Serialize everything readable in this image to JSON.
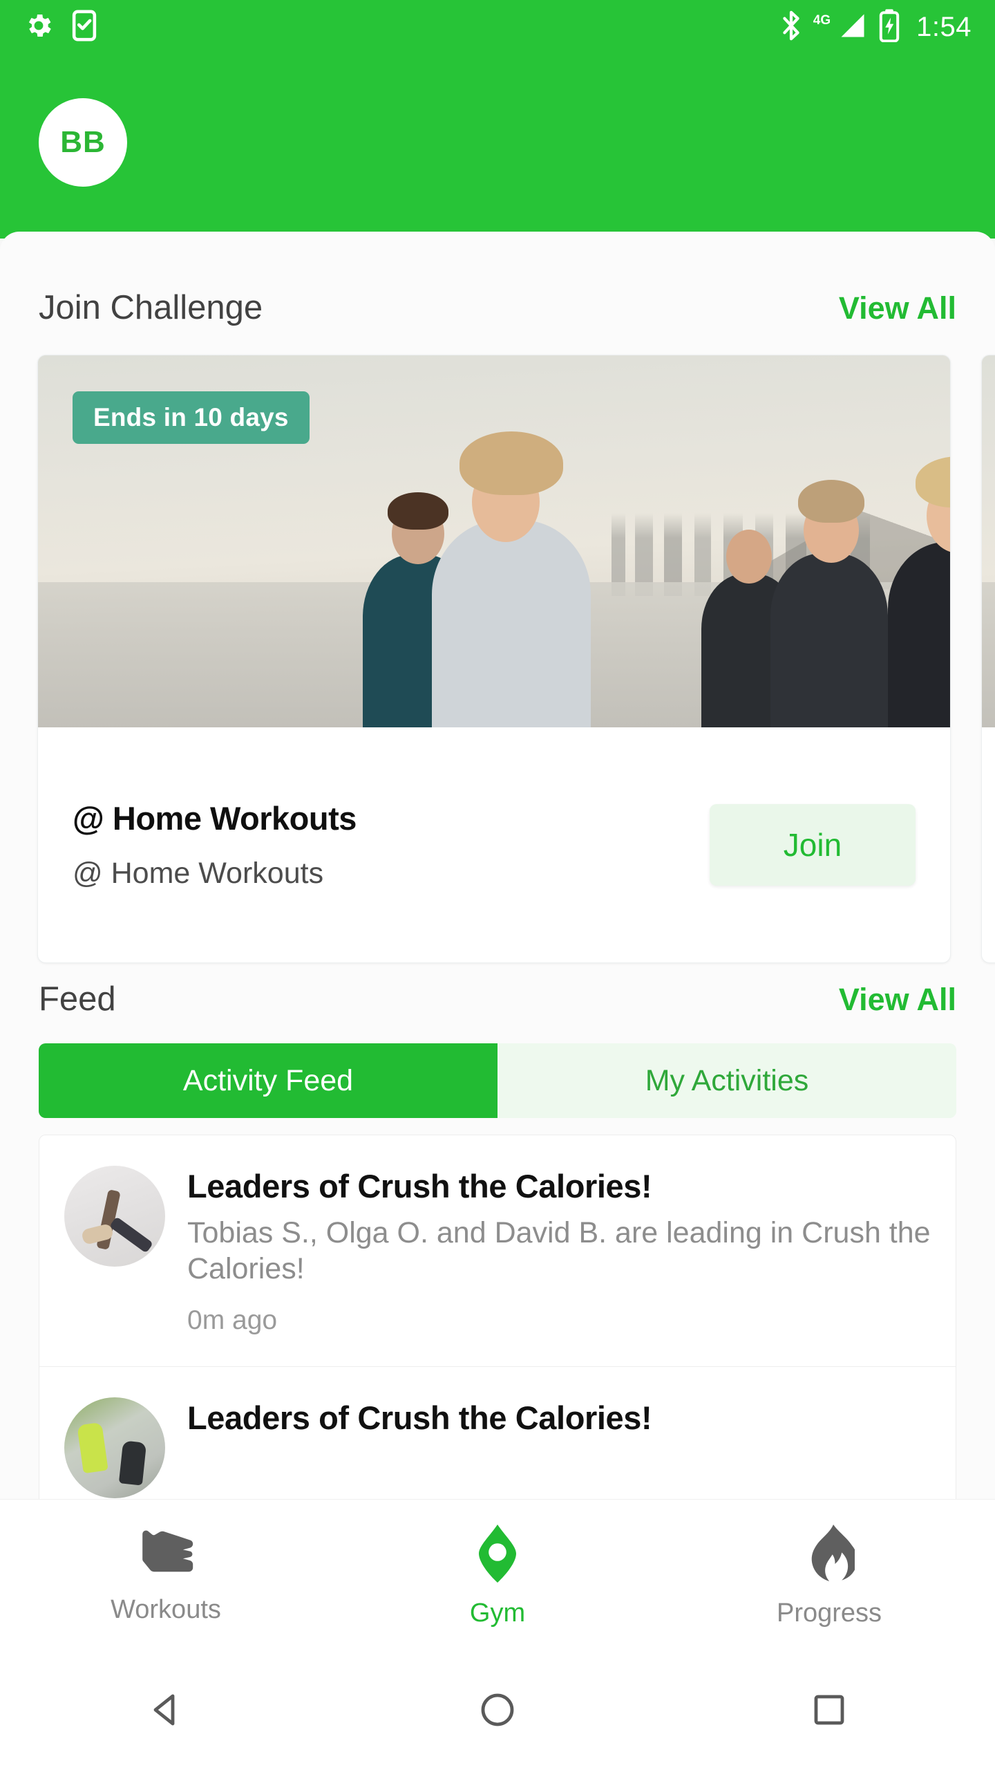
{
  "status_bar": {
    "time": "1:54",
    "network": "4G",
    "icons": [
      "gear-icon",
      "phone-check-icon",
      "bluetooth-icon",
      "signal-icon",
      "battery-charging-icon"
    ]
  },
  "header": {
    "avatar_initials": "BB",
    "background_color": "#27c437"
  },
  "challenge_section": {
    "title": "Join Challenge",
    "view_all_label": "View All",
    "cards": [
      {
        "badge": "Ends in 10 days",
        "name": "@ Home Workouts",
        "subtitle": "@ Home Workouts",
        "action_label": "Join"
      }
    ]
  },
  "feed_section": {
    "title": "Feed",
    "view_all_label": "View All",
    "tabs": [
      {
        "label": "Activity Feed",
        "active": true
      },
      {
        "label": "My Activities",
        "active": false
      }
    ],
    "items": [
      {
        "title": "Leaders of Crush the Calories!",
        "body": "Tobias S., Olga O. and David B. are leading in Crush the Calories!",
        "time": "0m ago",
        "thumb": "yoga-pose-photo"
      },
      {
        "title": "Leaders of Crush the Calories!",
        "body": "",
        "time": "",
        "thumb": "outdoor-running-photo"
      }
    ]
  },
  "bottom_nav": {
    "items": [
      {
        "label": "Workouts",
        "icon": "shoe-icon",
        "active": false
      },
      {
        "label": "Gym",
        "icon": "location-pin-icon",
        "active": true
      },
      {
        "label": "Progress",
        "icon": "flame-icon",
        "active": false
      }
    ]
  },
  "android_nav": {
    "back": "back-triangle-icon",
    "home": "home-circle-icon",
    "recents": "recents-square-icon"
  },
  "colors": {
    "brand_green": "#27c437",
    "accent_green": "#22bb33",
    "badge_teal": "#49a98c",
    "join_bg": "#eaf7ea"
  }
}
